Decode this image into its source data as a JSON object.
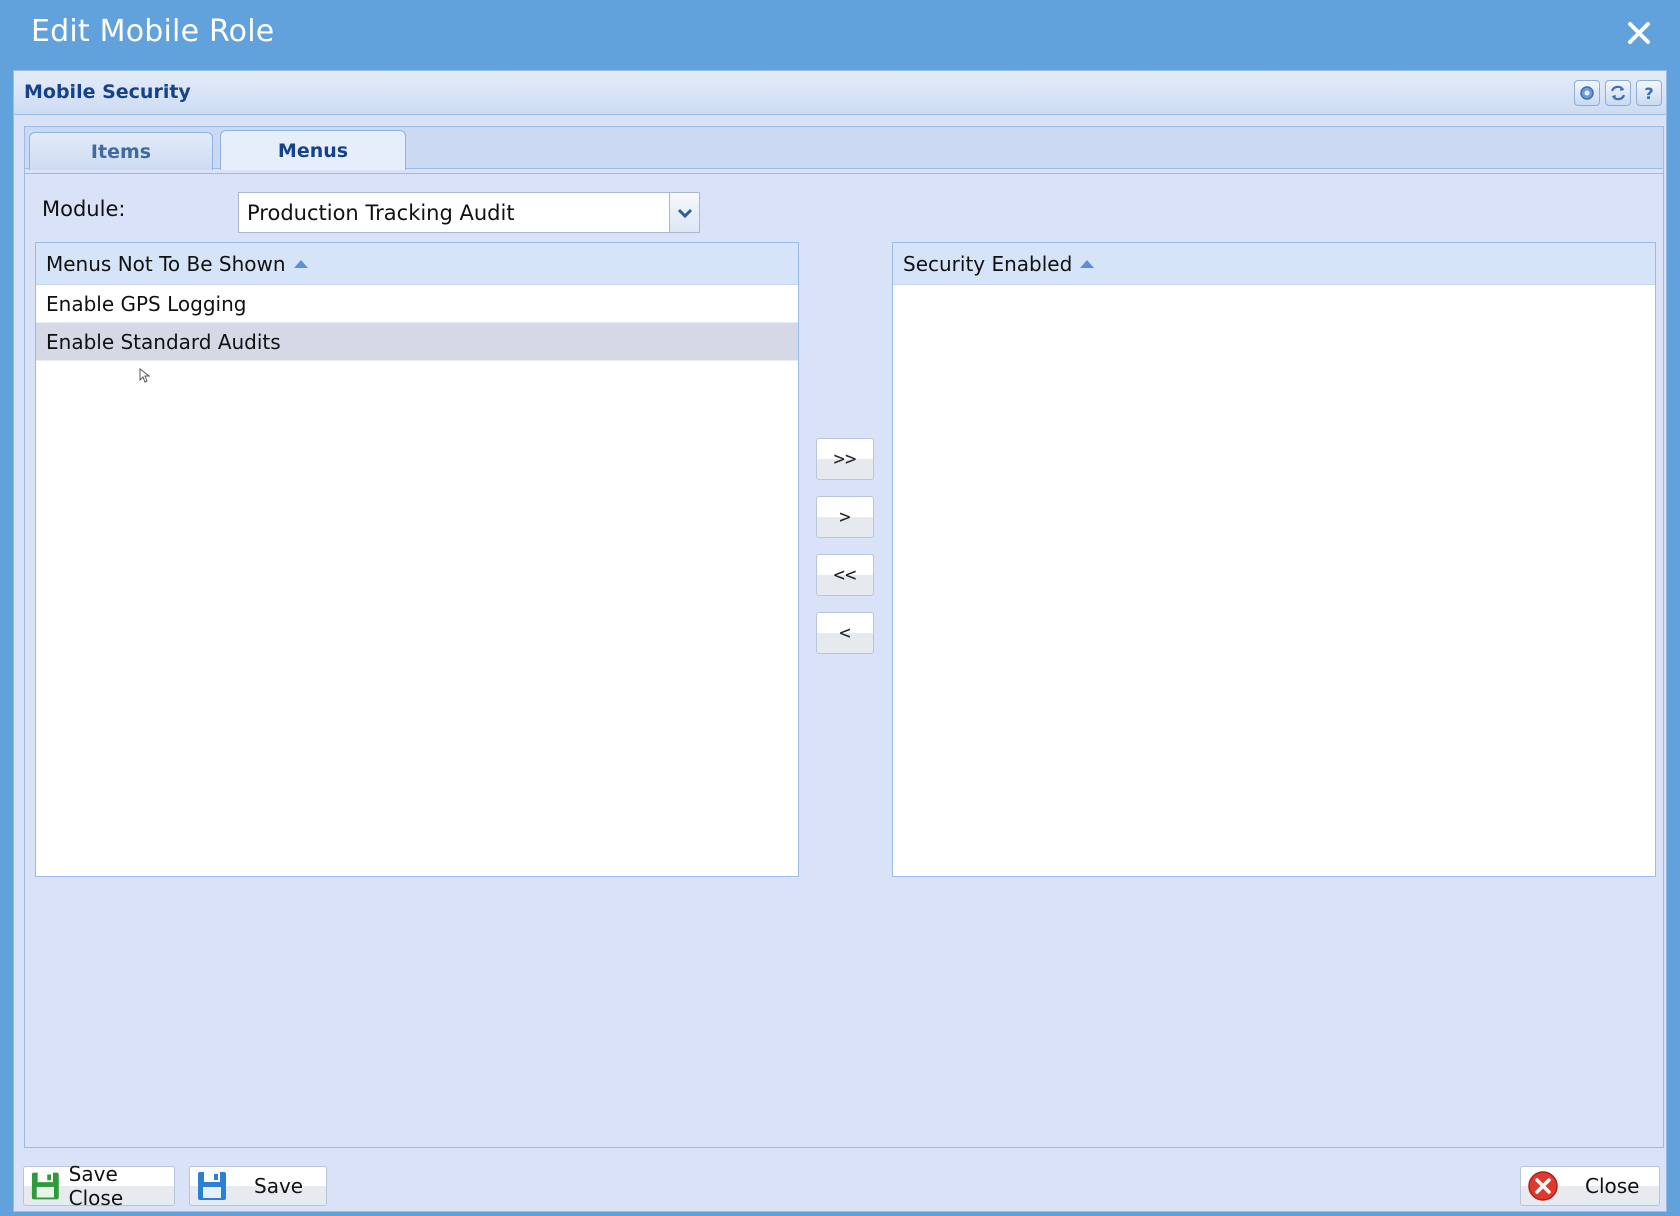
{
  "window": {
    "title": "Edit Mobile Role"
  },
  "panel": {
    "title": "Mobile Security",
    "tools": [
      "gear-icon",
      "refresh-icon",
      "help-icon"
    ]
  },
  "tabs": [
    {
      "label": "Items",
      "active": false
    },
    {
      "label": "Menus",
      "active": true
    }
  ],
  "module": {
    "label": "Module:",
    "value": "Production Tracking Audit"
  },
  "left_grid": {
    "header": "Menus Not To Be Shown",
    "rows": [
      "Enable GPS Logging",
      "Enable Standard Audits"
    ],
    "selected_row": "Enable Standard Audits"
  },
  "right_grid": {
    "header": "Security Enabled",
    "rows": []
  },
  "move_buttons": {
    "add_all": ">>",
    "add": ">",
    "remove_all": "<<",
    "remove": "<"
  },
  "footer": {
    "save_close": "Save Close",
    "save": "Save",
    "close": "Close"
  },
  "colors": {
    "title_bar": "#62a2dc",
    "panel_bg": "#d9e2f7",
    "accent": "#15428b",
    "selected_row": "#d4d9e5"
  }
}
